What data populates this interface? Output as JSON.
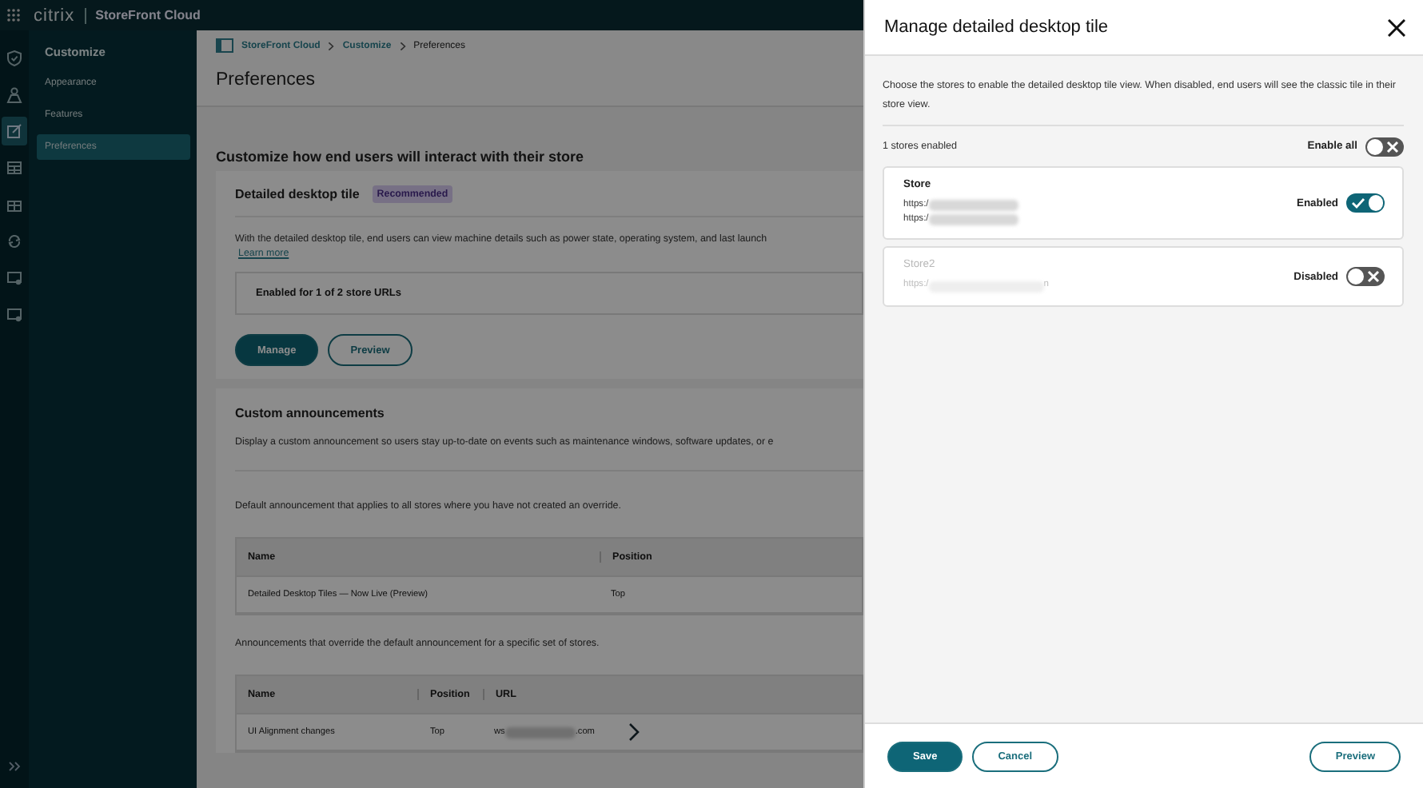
{
  "topbar": {
    "brand": "citrix",
    "product": "StoreFront Cloud"
  },
  "rail": {
    "icons": [
      {
        "kind": "shield",
        "selected": false
      },
      {
        "kind": "people",
        "selected": false
      },
      {
        "kind": "edit",
        "selected": true
      },
      {
        "kind": "grid",
        "selected": false
      },
      {
        "kind": "gift",
        "selected": false
      },
      {
        "kind": "sync",
        "selected": false
      },
      {
        "kind": "monitor",
        "selected": false
      },
      {
        "kind": "monitor",
        "selected": false
      }
    ]
  },
  "sidebar": {
    "title": "Customize",
    "items": [
      {
        "label": "Appearance",
        "selected": false
      },
      {
        "label": "Features",
        "selected": false
      },
      {
        "label": "Preferences",
        "selected": true
      }
    ]
  },
  "breadcrumb": [
    "StoreFront Cloud",
    "Customize",
    "Preferences"
  ],
  "page_title": "Preferences",
  "section_title": "Customize how end users will interact with their store",
  "tile_card": {
    "title": "Detailed desktop tile",
    "badge": "Recommended",
    "description": "With the detailed desktop tile, end users can view machine details such as power state, operating system, and last launch",
    "link": "Learn more",
    "status": "Enabled for 1 of 2 store URLs",
    "buttons": [
      {
        "label": "Manage",
        "kind": "primary"
      },
      {
        "label": "Preview",
        "kind": "secondary"
      }
    ]
  },
  "announcements": {
    "title": "Custom announcements",
    "description": "Display a custom announcement so users stay up-to-date on events such as maintenance windows, software updates, or e",
    "default_note": "Default announcement that applies to all stores where you have not created an override.",
    "default_table": {
      "columns": [
        "Name",
        "Position"
      ],
      "rows": [
        [
          "Detailed Desktop Tiles — Now Live (Preview)",
          "Top"
        ]
      ]
    },
    "override_note": "Announcements that override the default announcement for a specific set of stores.",
    "override_table": {
      "columns": [
        "Name",
        "Position",
        "URL"
      ],
      "rows": [
        {
          "name": "UI Alignment changes",
          "position": "Top",
          "url_prefix": "ws",
          "url_suffix": ".com"
        }
      ]
    }
  },
  "dialog": {
    "title": "Manage detailed desktop tile",
    "description": "Choose the stores to enable the detailed desktop tile view. When disabled, end users will see the classic tile in their store view.",
    "count": "1 stores enabled",
    "enable_all": {
      "label": "Enable all",
      "on": false
    },
    "stores": [
      {
        "name": "Store",
        "urls": [
          {
            "prefix": "https:/"
          },
          {
            "prefix": "https:/"
          }
        ],
        "state_label": "Enabled",
        "on": true,
        "disabled": false
      },
      {
        "name": "Store2",
        "urls": [
          {
            "prefix": "https:/",
            "suffix": "n"
          }
        ],
        "state_label": "Disabled",
        "on": false,
        "disabled": true
      }
    ],
    "footer": {
      "save": "Save",
      "cancel": "Cancel",
      "preview": "Preview"
    }
  }
}
